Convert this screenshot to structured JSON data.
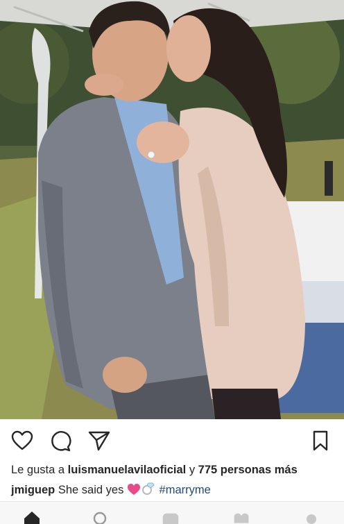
{
  "post": {
    "likes": {
      "prefix": "Le gusta a ",
      "user": "luismanuelavilaoficial",
      "connector": " y ",
      "count_text": "775 personas más"
    },
    "caption": {
      "username": "jmiguep",
      "text": "She said yes",
      "hashtag": "#marryme"
    }
  },
  "icons": {
    "like": "heart-icon",
    "comment": "comment-icon",
    "share": "paper-plane-icon",
    "save": "bookmark-icon"
  },
  "bottom_nav": [
    "home-icon",
    "search-icon",
    "add-post-icon",
    "activity-heart-icon",
    "profile-icon"
  ],
  "colors": {
    "text": "#262626",
    "hashtag": "#1f4a7a",
    "heart_emoji": "#e84a8a"
  }
}
